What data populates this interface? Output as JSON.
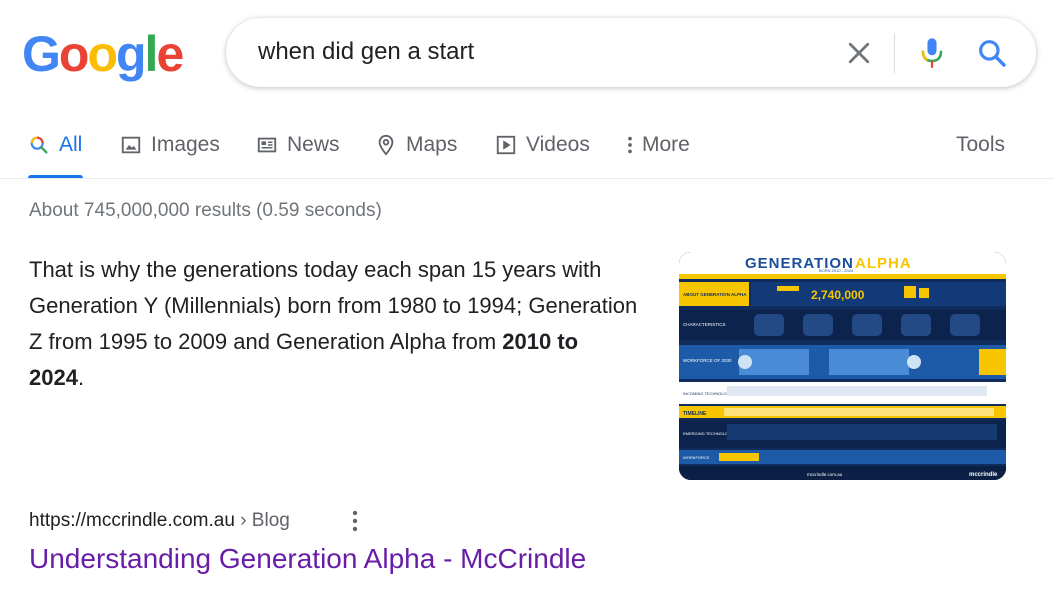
{
  "logo": {
    "letters": [
      "G",
      "o",
      "o",
      "g",
      "l",
      "e"
    ],
    "colors": [
      "#4285F4",
      "#EA4335",
      "#FBBC05",
      "#4285F4",
      "#34A853",
      "#EA4335"
    ]
  },
  "search": {
    "query": "when did gen a start"
  },
  "tabs": [
    {
      "label": "All",
      "icon": "search-icon"
    },
    {
      "label": "Images",
      "icon": "image-icon"
    },
    {
      "label": "News",
      "icon": "news-icon"
    },
    {
      "label": "Maps",
      "icon": "map-pin-icon"
    },
    {
      "label": "Videos",
      "icon": "play-icon"
    },
    {
      "label": "More",
      "icon": "vertical-dots-icon"
    }
  ],
  "tools_label": "Tools",
  "stats": "About 745,000,000 results (0.59 seconds)",
  "snippet": {
    "text": "That is why the generations today each span 15 years with Generation Y (Millennials) born from 1980 to 1994; Generation Z from 1995 to 2009 and Generation Alpha from ",
    "bold": "2010 to 2024",
    "tail": "."
  },
  "thumbnail": {
    "title_a": "GENERATION",
    "title_b": "ALPHA",
    "subtitle": "BORN 2010 - 2024",
    "big_number": "2,740,000",
    "labels": [
      "ABOUT GENERATION ALPHA",
      "CHARACTERISTICS",
      "WORKFORCE OF 2030",
      "INCOMING TECHNOLOGY",
      "TIMELINE",
      "EMERGING TECHNOLOGY",
      "WORKFORCE",
      "MID-2025"
    ],
    "footer": "mccrindle.com.au",
    "brand": "mccrindle"
  },
  "result": {
    "url": "https://mccrindle.com.au",
    "breadcrumb": " › Blog",
    "title": "Understanding Generation Alpha - McCrindle"
  },
  "colors": {
    "accent": "#1a73e8",
    "visited": "#681da8",
    "muted": "#70757a"
  }
}
